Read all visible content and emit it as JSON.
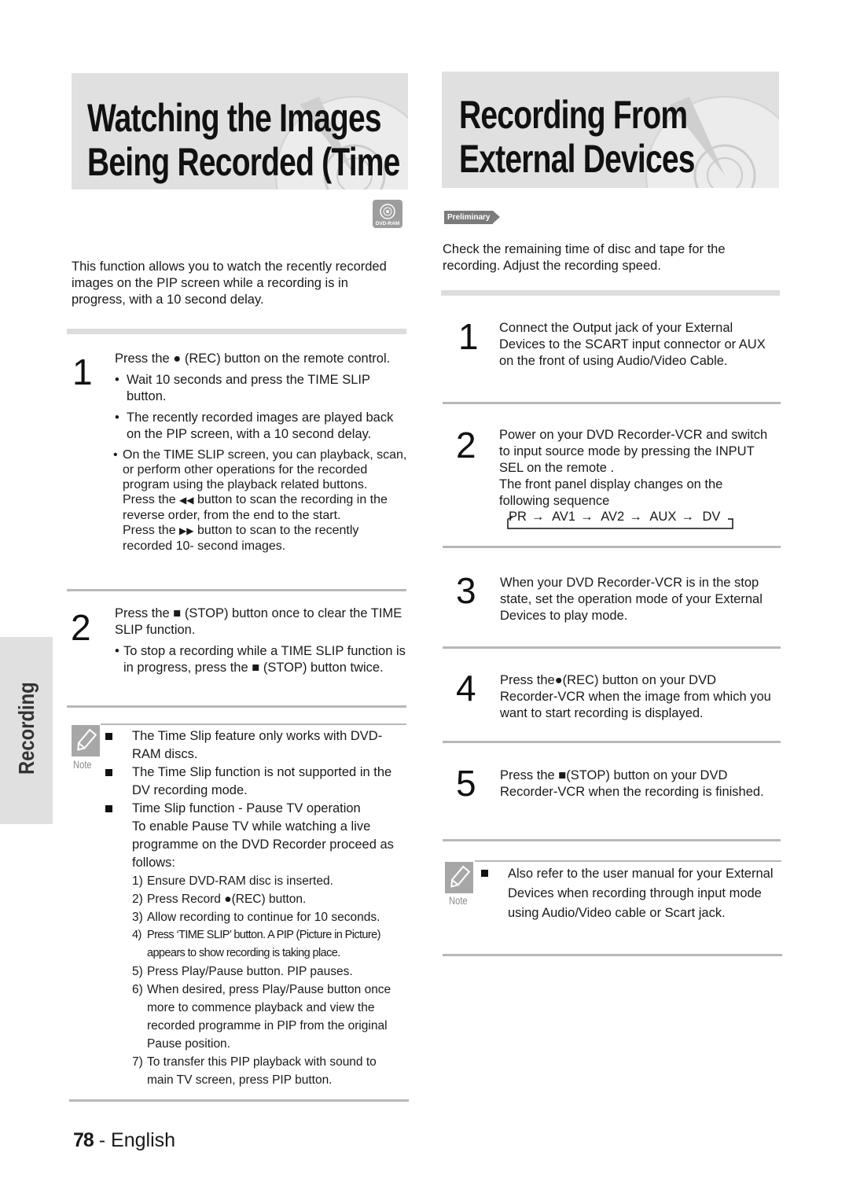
{
  "side_tab": {
    "label": "Recording"
  },
  "left": {
    "title_line1": "Watching the Images",
    "title_line2": "Being Recorded (Time Slip)",
    "disc_badge": "DVD-RAM",
    "intro": "This function allows you to watch the recently recorded images on the PIP screen while a recording is in progress, with a 10 second delay.",
    "step1": {
      "num": "1",
      "main_pre": "Press the",
      "main_post": "(REC) button on the remote control.",
      "bullet1": "Wait 10 seconds and press the TIME SLIP button.",
      "bullet2": "The recently recorded images are played back on the PIP screen, with a 10 second delay.",
      "bullet3": "On the TIME SLIP screen, you can playback, scan, or perform other operations for the recorded program using the playback related buttons.",
      "rew_pre": "Press the",
      "rew_post": "button to scan the recording in the reverse order, from the end to the start.",
      "ff_pre": "Press the",
      "ff_post": "button to scan to the recently recorded  10- second images."
    },
    "step2": {
      "num": "2",
      "main_pre": "Press the",
      "main_post": "(STOP) button once to clear the TIME SLIP function.",
      "bullet_pre": "To stop a recording while a TIME SLIP function is in progress, press the",
      "bullet_post": "(STOP) button twice."
    },
    "note": {
      "label": "Note",
      "items": [
        "The Time Slip feature only works with DVD-RAM discs.",
        "The Time Slip function is not supported in the DV recording mode.",
        "Time Slip function - Pause TV operation"
      ],
      "pause_intro": "To enable Pause TV while watching a live programme on the DVD Recorder proceed as follows:",
      "steps": [
        {
          "n": "1)",
          "text": "Ensure DVD-RAM disc is inserted."
        },
        {
          "n": "2)",
          "text_pre": "Press Record",
          "text_post": "(REC) button."
        },
        {
          "n": "3)",
          "text": "Allow recording to continue for 10 seconds."
        },
        {
          "n": "4)",
          "text": "Press ‘TIME SLIP’ button. A PIP (Picture in Picture) appears to show recording is taking place."
        },
        {
          "n": "5)",
          "text": "Press Play/Pause button. PIP pauses."
        },
        {
          "n": "6)",
          "text": "When desired, press Play/Pause button once more to commence playback and view the recorded programme in PIP from the original Pause position."
        },
        {
          "n": "7)",
          "text": "To transfer this PIP playback with sound to main TV screen, press PIP button."
        }
      ]
    }
  },
  "right": {
    "title_line1": "Recording From",
    "title_line2": "External Devices",
    "badge": "Preliminary",
    "intro": "Check the remaining time of disc and tape for the recording. Adjust the recording speed.",
    "steps": [
      {
        "num": "1",
        "text": "Connect the Output jack of your External Devices to the SCART input connector or AUX on the front of using Audio/Video Cable."
      },
      {
        "num": "2",
        "text": "Power on your DVD Recorder-VCR and switch to input source mode by pressing the INPUT SEL on the remote .",
        "text2": "The front panel display changes on the following sequence"
      },
      {
        "num": "3",
        "text": "When your DVD Recorder-VCR is in the stop state, set the operation mode of your External Devices to play mode."
      },
      {
        "num": "4",
        "text_pre": "Press the",
        "text_post": "(REC) button on your DVD Recorder-VCR when the image from which you want to start recording is displayed."
      },
      {
        "num": "5",
        "text_pre": "Press the",
        "text_post": "(STOP) button on your DVD Recorder-VCR when the recording is finished."
      }
    ],
    "sequence": [
      "PR",
      "AV1",
      "AV2",
      "AUX",
      "DV"
    ],
    "note": {
      "label": "Note",
      "text": "Also refer to the user manual for your External Devices when recording through input mode using Audio/Video cable or Scart jack."
    }
  },
  "footer": {
    "page_number": "78",
    "separator": "-",
    "language": "English"
  }
}
